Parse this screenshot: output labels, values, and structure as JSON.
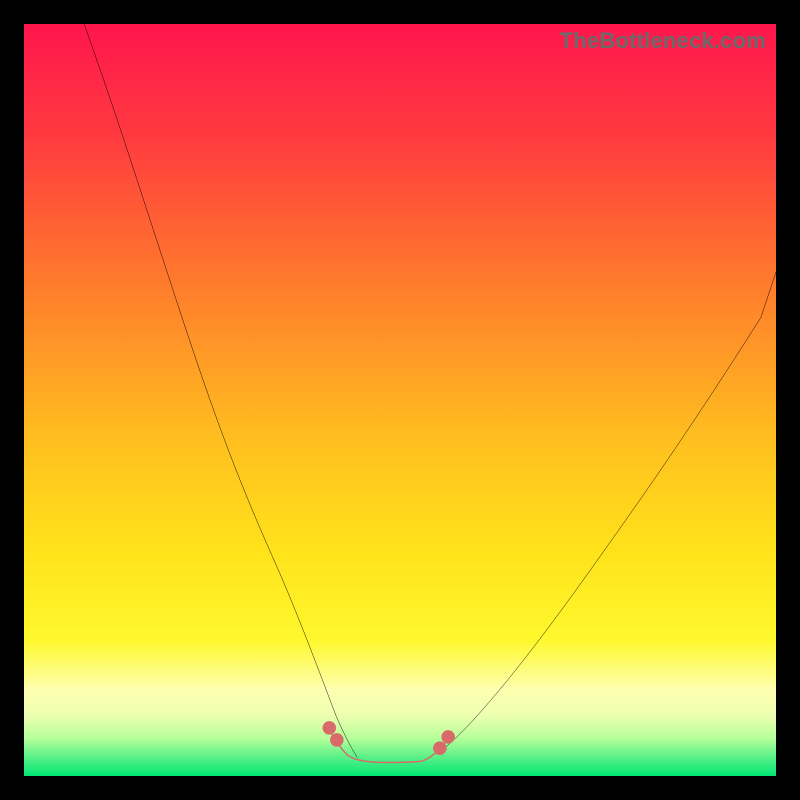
{
  "watermark": {
    "text": "TheBottleneck.com"
  },
  "colors": {
    "top": "#ff164d",
    "yellow_mid": "#ffde1c",
    "pale_yellow": "#feffb0",
    "light_green": "#b5ff99",
    "green_base": "#00e773",
    "curve_stroke": "#000000",
    "marker_fill": "#d86a6a",
    "marker_stroke": "#c95a5a"
  },
  "chart_data": {
    "type": "line",
    "title": "",
    "xlabel": "",
    "ylabel": "",
    "xlim": [
      0,
      100
    ],
    "ylim": [
      0,
      100
    ],
    "grid": false,
    "legend": false,
    "annotations": [],
    "series": [
      {
        "name": "left-curve",
        "x": [
          8,
          10,
          12,
          16,
          20,
          24,
          28,
          32,
          36,
          38,
          40,
          41.5,
          43,
          44
        ],
        "y": [
          100,
          92,
          84,
          69,
          56,
          44,
          33,
          23,
          14,
          10,
          6,
          4,
          3,
          2.5
        ]
      },
      {
        "name": "right-curve",
        "x": [
          55,
          56.5,
          58,
          60,
          64,
          68,
          74,
          80,
          86,
          92,
          98,
          100
        ],
        "y": [
          3,
          4,
          5,
          7,
          11,
          16,
          24,
          33,
          43,
          53,
          63,
          67
        ]
      },
      {
        "name": "valley-markers",
        "x": [
          41,
          42,
          43,
          44,
          46,
          48,
          50,
          52,
          53,
          54,
          55,
          56
        ],
        "y": [
          5,
          4,
          3,
          2.5,
          2,
          2,
          2,
          2,
          2.5,
          3,
          3.5,
          4
        ]
      }
    ],
    "valley_range_x": [
      41,
      56
    ],
    "valley_min_y": 2
  }
}
